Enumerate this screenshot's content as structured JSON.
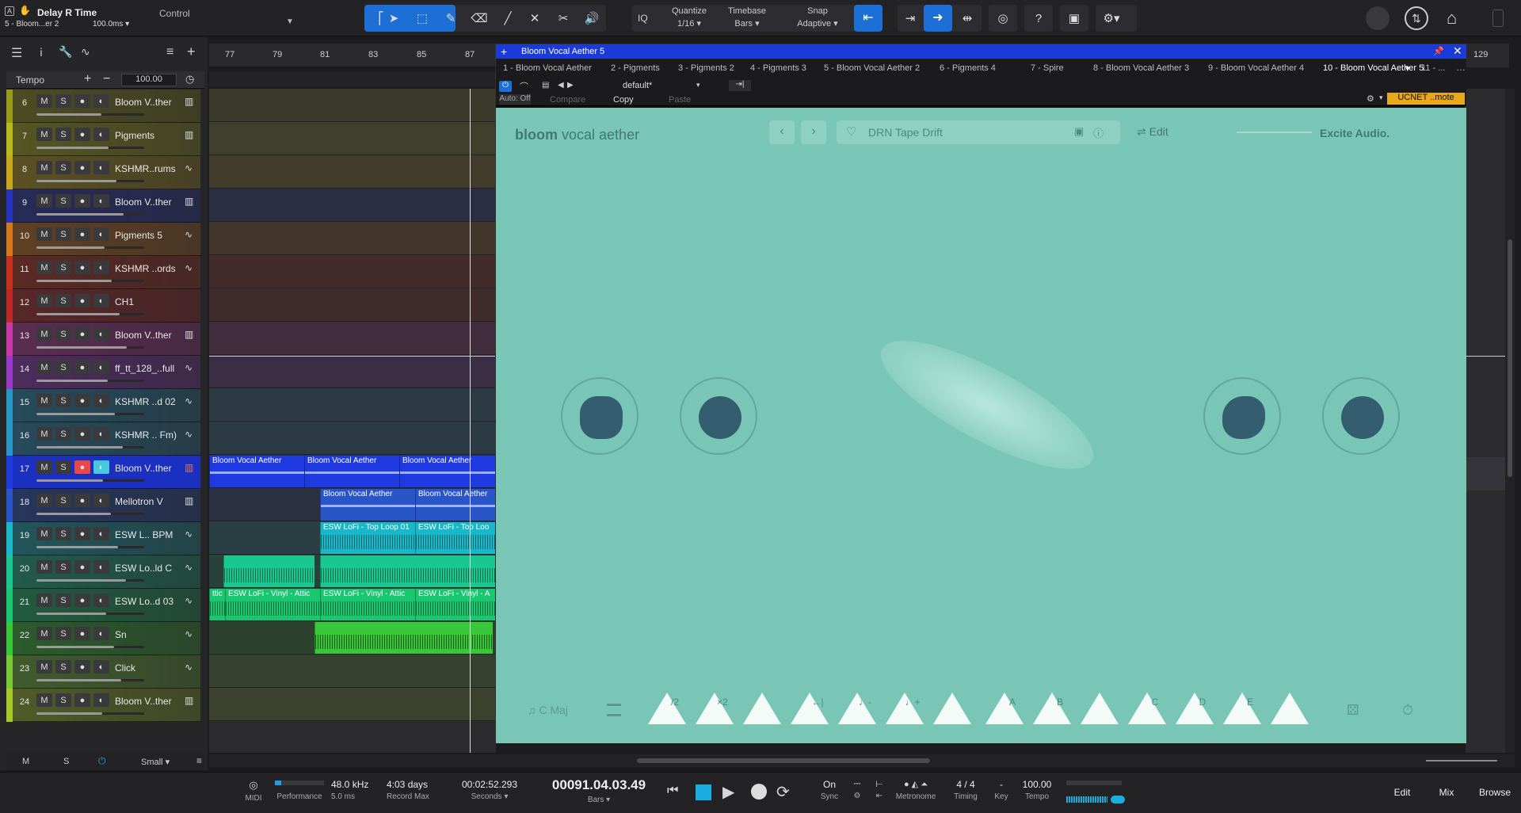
{
  "toolbar": {
    "track_title": "Delay R Time",
    "track_sub": "5 - Bloom...er 2",
    "param_value": "100.0ms",
    "control_label": "Control",
    "iq_label": "IQ",
    "quantize_label": "Quantize",
    "quantize_value": "1/16",
    "timebase_label": "Timebase",
    "timebase_value": "Bars",
    "snap_label": "Snap",
    "snap_value": "Adaptive",
    "help_label": "?"
  },
  "tempo_row": {
    "label": "Tempo",
    "value": "100.00"
  },
  "ruler": {
    "left_marks": [
      "77",
      "79",
      "81",
      "83",
      "85",
      "87"
    ],
    "right_mark": "129"
  },
  "tracks": [
    {
      "num": "6",
      "name": "Bloom V..ther",
      "icon": "piano-icon",
      "color": "#9a9a1a"
    },
    {
      "num": "7",
      "name": "Pigments",
      "icon": "piano-icon",
      "color": "#b8b81a"
    },
    {
      "num": "8",
      "name": "KSHMR..rums",
      "icon": "wave-icon",
      "color": "#c8a81a"
    },
    {
      "num": "9",
      "name": "Bloom V..ther",
      "icon": "piano-icon",
      "color": "#2535c0"
    },
    {
      "num": "10",
      "name": "Pigments 5",
      "icon": "wave-icon",
      "color": "#d8761a"
    },
    {
      "num": "11",
      "name": "KSHMR ..ords",
      "icon": "wave-icon",
      "color": "#c8301a"
    },
    {
      "num": "12",
      "name": "CH1",
      "icon": "",
      "color": "#c02828"
    },
    {
      "num": "13",
      "name": "Bloom V..ther",
      "icon": "piano-icon",
      "color": "#c838a8"
    },
    {
      "num": "14",
      "name": "ff_tt_128_..full",
      "icon": "wave-icon",
      "color": "#9a38c8"
    },
    {
      "num": "15",
      "name": "KSHMR ..d 02",
      "icon": "wave-icon",
      "color": "#2896c8"
    },
    {
      "num": "16",
      "name": "KSHMR .. Fm)",
      "icon": "wave-icon",
      "color": "#2896c8"
    },
    {
      "num": "17",
      "name": "Bloom V..ther",
      "icon": "piano-icon",
      "color": "#1e3ae0"
    },
    {
      "num": "18",
      "name": "Mellotron V",
      "icon": "piano-icon",
      "color": "#2856c8"
    },
    {
      "num": "19",
      "name": "ESW L.. BPM",
      "icon": "wave-icon",
      "color": "#18b8c8"
    },
    {
      "num": "20",
      "name": "ESW Lo..ld C",
      "icon": "wave-icon",
      "color": "#18c890"
    },
    {
      "num": "21",
      "name": "ESW Lo..d 03",
      "icon": "wave-icon",
      "color": "#18c870"
    },
    {
      "num": "22",
      "name": "Sn",
      "icon": "wave-icon",
      "color": "#38c838"
    },
    {
      "num": "23",
      "name": "Click",
      "icon": "wave-icon",
      "color": "#78c838"
    },
    {
      "num": "24",
      "name": "Bloom V..ther",
      "icon": "piano-icon",
      "color": "#a8c828"
    }
  ],
  "track_buttons": {
    "mute": "M",
    "solo": "S"
  },
  "clips": {
    "bloom": "Bloom Vocal Aether",
    "topLoop": "ESW LoFi - Top Loop 01",
    "topLoop_short": "ESW LoFi - Top Loo",
    "vinyl": "ESW LoFi - Vinyl - Attic",
    "vinyl_short": "ESW LoFi - Vinyl - A",
    "vinyl_left": "ttic"
  },
  "left_footer": {
    "m": "M",
    "s": "S",
    "size": "Small"
  },
  "plugin": {
    "title": "Bloom Vocal Aether 5",
    "tabs": [
      "1 - Bloom Vocal Aether",
      "2 - Pigments",
      "3 - Pigments 2",
      "4 - Pigments 3",
      "5 - Bloom Vocal Aether 2",
      "6 - Pigments 4",
      "7 - Spire",
      "8 - Bloom Vocal Aether 3",
      "9 - Bloom Vocal Aether 4",
      "10 - Bloom Vocal Aether 5",
      "11 - ..."
    ],
    "auto": "Auto: Off",
    "compare": "Compare",
    "copy": "Copy",
    "paste": "Paste",
    "preset": "default*",
    "remote": "UCNET ..mote"
  },
  "bloom": {
    "logo_bold": "bloom",
    "logo_light": "vocal aether",
    "preset_name": "DRN Tape Drift",
    "edit_label": "Edit",
    "brand": "Excite Audio.",
    "key_label": "C Maj",
    "pad_labels": [
      "/2",
      "×2",
      "←|",
      "♩-",
      "♩+",
      "A",
      "B",
      "C",
      "D",
      "E"
    ]
  },
  "transport": {
    "midi": "MIDI",
    "performance": "Performance",
    "sample_rate": "48.0 kHz",
    "latency": "5.0 ms",
    "record_days": "4:03 days",
    "record_max": "Record Max",
    "seconds_time": "00:02:52.293",
    "seconds_label": "Seconds",
    "bars_time": "00091.04.03.49",
    "bars_label": "Bars",
    "sync_on": "On",
    "sync_label": "Sync",
    "metronome": "Metronome",
    "timing_value": "4 / 4",
    "timing_label": "Timing",
    "key_value": "-",
    "key_label": "Key",
    "tempo_value": "100.00",
    "tempo_label": "Tempo",
    "edit": "Edit",
    "mix": "Mix",
    "browse": "Browse"
  }
}
